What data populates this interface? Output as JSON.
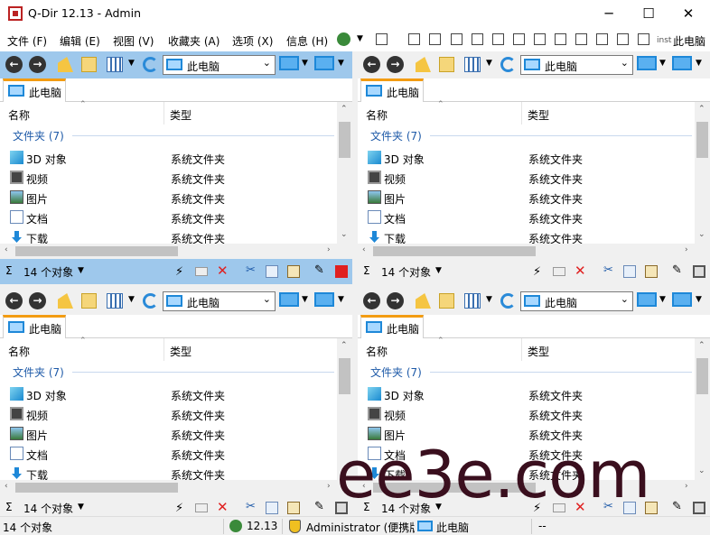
{
  "window": {
    "title": "Q-Dir 12.13 - Admin",
    "minimize": "─",
    "maximize": "☐",
    "close": "✕"
  },
  "menu": {
    "items": [
      "文件 (F)",
      "编辑 (E)",
      "视图 (V)",
      "收藏夹 (A)",
      "选项 (X)",
      "信息 (H)"
    ],
    "inst_label": "inst",
    "this_pc": "此电脑"
  },
  "panes": [
    {
      "address": "此电脑",
      "tab_label": "此电脑",
      "columns": [
        "名称",
        "类型"
      ],
      "group_label": "文件夹 (7)",
      "items": [
        {
          "name": "3D 对象",
          "type": "系统文件夹",
          "icon": "3d-objects-icon"
        },
        {
          "name": "视频",
          "type": "系统文件夹",
          "icon": "video-folder-icon"
        },
        {
          "name": "图片",
          "type": "系统文件夹",
          "icon": "pictures-folder-icon"
        },
        {
          "name": "文档",
          "type": "系统文件夹",
          "icon": "documents-folder-icon"
        },
        {
          "name": "下载",
          "type": "系统文件夹",
          "icon": "downloads-folder-icon"
        }
      ],
      "count": "14 个对象",
      "active": true
    },
    {
      "address": "此电脑",
      "tab_label": "此电脑",
      "columns": [
        "名称",
        "类型"
      ],
      "group_label": "文件夹 (7)",
      "items": [
        {
          "name": "3D 对象",
          "type": "系统文件夹",
          "icon": "3d-objects-icon"
        },
        {
          "name": "视频",
          "type": "系统文件夹",
          "icon": "video-folder-icon"
        },
        {
          "name": "图片",
          "type": "系统文件夹",
          "icon": "pictures-folder-icon"
        },
        {
          "name": "文档",
          "type": "系统文件夹",
          "icon": "documents-folder-icon"
        },
        {
          "name": "下载",
          "type": "系统文件夹",
          "icon": "downloads-folder-icon"
        }
      ],
      "count": "14 个对象",
      "active": false
    },
    {
      "address": "此电脑",
      "tab_label": "此电脑",
      "columns": [
        "名称",
        "类型"
      ],
      "group_label": "文件夹 (7)",
      "items": [
        {
          "name": "3D 对象",
          "type": "系统文件夹",
          "icon": "3d-objects-icon"
        },
        {
          "name": "视频",
          "type": "系统文件夹",
          "icon": "video-folder-icon"
        },
        {
          "name": "图片",
          "type": "系统文件夹",
          "icon": "pictures-folder-icon"
        },
        {
          "name": "文档",
          "type": "系统文件夹",
          "icon": "documents-folder-icon"
        },
        {
          "name": "下载",
          "type": "系统文件夹",
          "icon": "downloads-folder-icon"
        }
      ],
      "count": "14 个对象",
      "active": false
    },
    {
      "address": "此电脑",
      "tab_label": "此电脑",
      "columns": [
        "名称",
        "类型"
      ],
      "group_label": "文件夹 (7)",
      "items": [
        {
          "name": "3D 对象",
          "type": "系统文件夹",
          "icon": "3d-objects-icon"
        },
        {
          "name": "视频",
          "type": "系统文件夹",
          "icon": "video-folder-icon"
        },
        {
          "name": "图片",
          "type": "系统文件夹",
          "icon": "pictures-folder-icon"
        },
        {
          "name": "文档",
          "type": "系统文件夹",
          "icon": "documents-folder-icon"
        },
        {
          "name": "下载",
          "type": "系统文件夹",
          "icon": "downloads-folder-icon"
        }
      ],
      "count": "14 个对象",
      "active": false
    }
  ],
  "statusbar": {
    "count": "14 个对象",
    "version": "12.13",
    "user": "Administrator (便携版",
    "location": "此电脑",
    "extra": "--"
  },
  "watermark": "ee3e.com",
  "colors": {
    "active_pane": "#9ec8ec",
    "tab_accent": "#f39c12",
    "group_text": "#1e5aa8",
    "delete_red": "#e02020"
  }
}
